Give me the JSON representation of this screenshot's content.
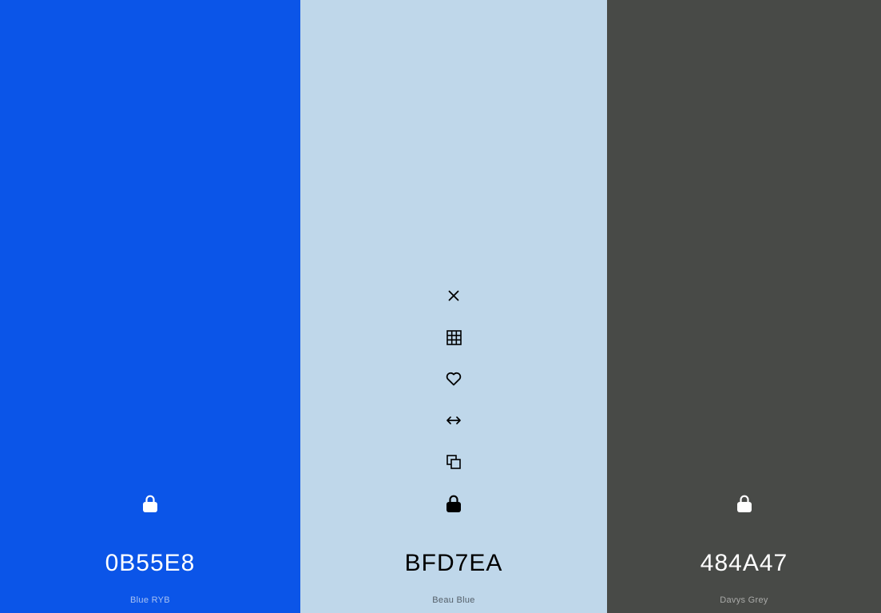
{
  "swatches": [
    {
      "hex": "0B55E8",
      "name": "Blue RYB",
      "bg": "#0B55E8",
      "fg": "#FFFFFF",
      "name_color": "#A9C2F2",
      "locked": true
    },
    {
      "hex": "BFD7EA",
      "name": "Beau Blue",
      "bg": "#BFD7EA",
      "fg": "#000000",
      "name_color": "#55606A",
      "locked": true
    },
    {
      "hex": "484A47",
      "name": "Davys Grey",
      "bg": "#484A47",
      "fg": "#FFFFFF",
      "name_color": "#A9AAA8",
      "locked": true
    }
  ],
  "toolbar_icons": [
    "close-icon",
    "shades-grid-icon",
    "heart-icon",
    "drag-arrows-icon",
    "copy-icon"
  ],
  "lock_icon": "lock-icon"
}
